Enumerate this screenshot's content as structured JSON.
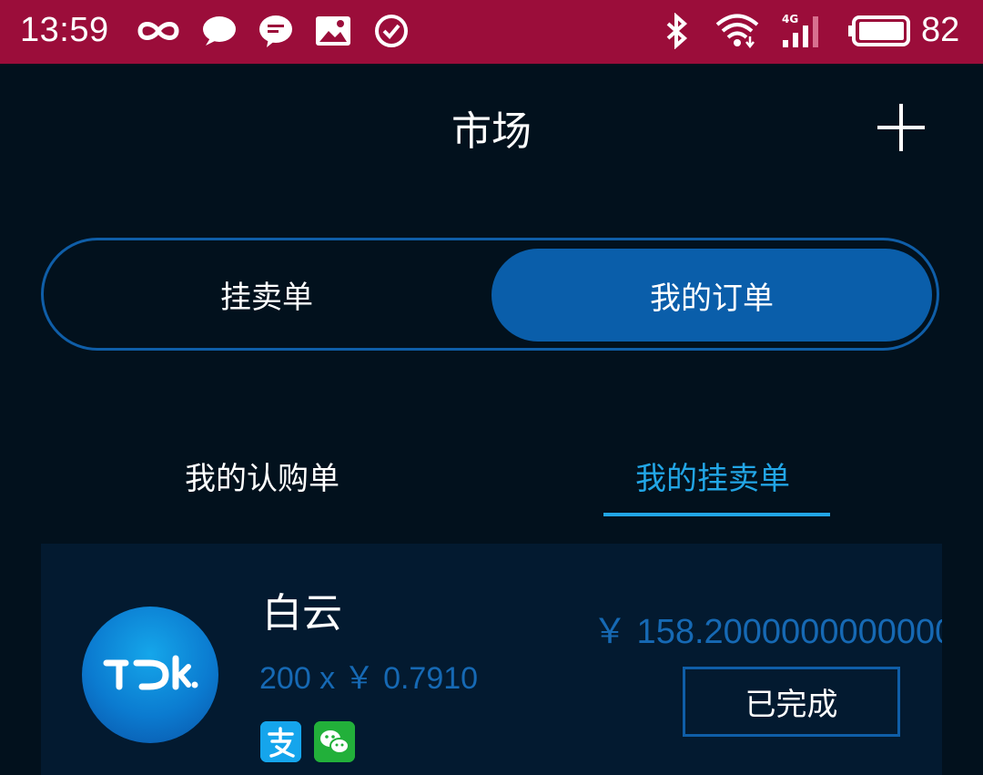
{
  "status_bar": {
    "time": "13:59",
    "battery": "82",
    "icons": [
      "infinity-icon",
      "chat-bubble-icon",
      "message-icon",
      "image-icon",
      "check-circle-icon",
      "bluetooth-icon",
      "wifi-icon",
      "signal-4g-icon",
      "battery-icon"
    ],
    "background": "#9b0d3a"
  },
  "header": {
    "title": "市场",
    "add_icon": "plus-icon"
  },
  "segmented": {
    "left_label": "挂卖单",
    "right_label": "我的订单",
    "active": "right",
    "accent": "#0a5eaa"
  },
  "subtabs": {
    "left_label": "我的认购单",
    "right_label": "我的挂卖单",
    "active": "right",
    "active_color": "#22a6e6"
  },
  "order": {
    "avatar_icon": "tdk-logo-icon",
    "name": "白云",
    "qty_price": "200 x ￥ 0.7910",
    "total": "￥ 158.2000000000000",
    "status_label": "已完成",
    "payment_icons": [
      "alipay-icon",
      "wechat-pay-icon"
    ]
  }
}
